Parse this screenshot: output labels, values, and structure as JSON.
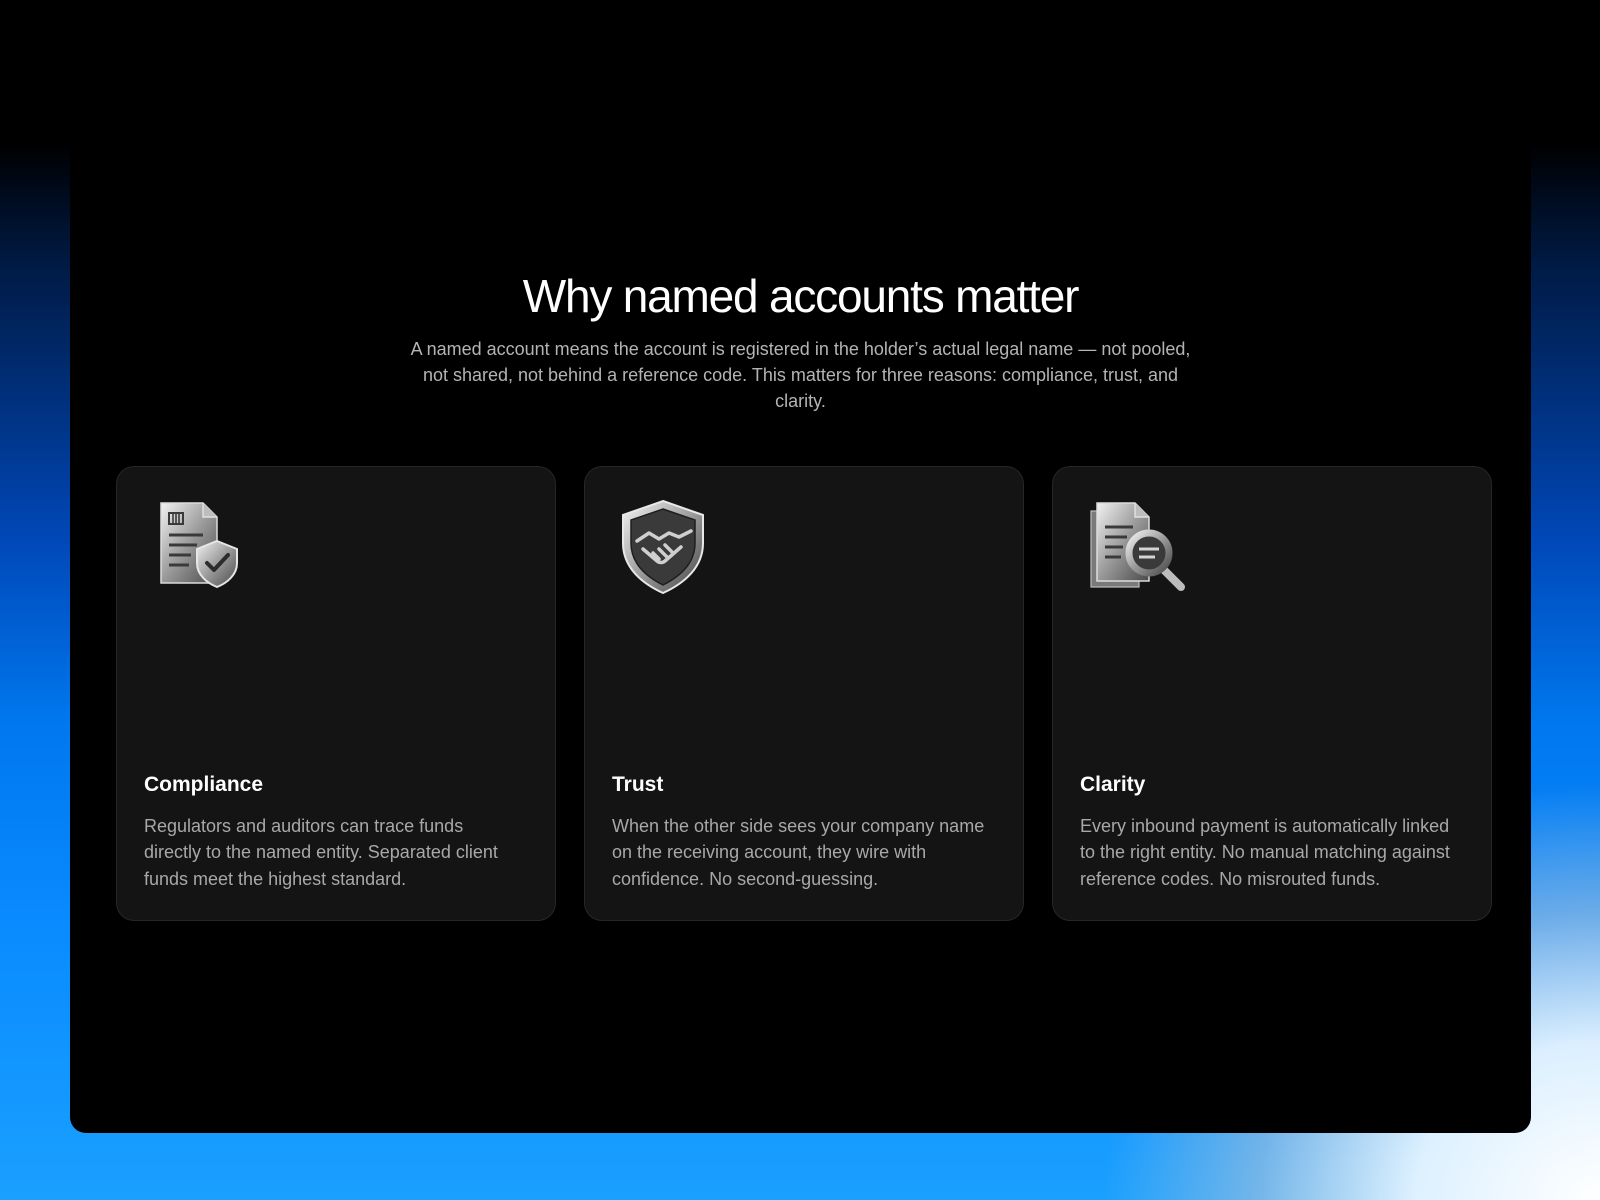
{
  "section": {
    "title": "Why named accounts matter",
    "subtitle": "A named account means the account is registered in the holder’s actual legal name — not pooled, not shared, not behind a reference code. This matters for three reasons: compliance, trust, and clarity."
  },
  "cards": [
    {
      "icon": "document-shield-icon",
      "title": "Compliance",
      "description": "Regulators and auditors can trace funds directly to the named entity. Separated client funds meet the highest standard."
    },
    {
      "icon": "handshake-shield-icon",
      "title": "Trust",
      "description": "When the other side sees your company name on the receiving account, they wire with confidence. No second-guessing."
    },
    {
      "icon": "document-magnifier-icon",
      "title": "Clarity",
      "description": "Every inbound payment is automatically linked to the right entity. No manual matching against reference codes. No misrouted funds."
    }
  ],
  "colors": {
    "panel_background": "#000000",
    "card_background": "#141414",
    "accent_gradient_blue": "#0a8cff"
  }
}
